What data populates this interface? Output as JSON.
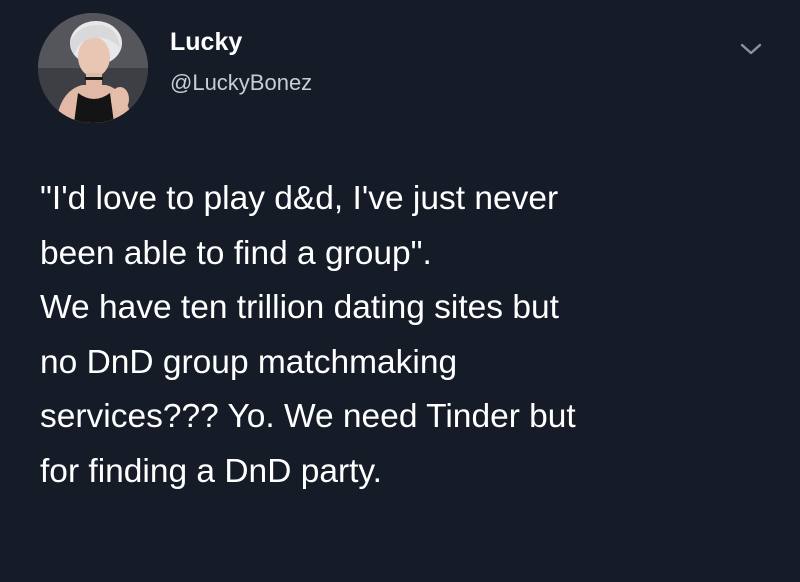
{
  "tweet": {
    "author": {
      "display_name": "Lucky",
      "handle": "@LuckyBonez",
      "avatar_icon": "profile-photo"
    },
    "menu_icon": "chevron-down-icon",
    "text_lines": [
      "\"I'd love to play d&d, I've just never",
      "been able to find a group\".",
      "We have ten trillion dating sites but",
      "no DnD group matchmaking",
      "services??? Yo. We need Tinder but",
      "for finding a DnD party."
    ]
  },
  "colors": {
    "background": "#151c27",
    "text": "#ffffff",
    "handle": "#c9cdd3",
    "chevron": "#8a939e"
  }
}
